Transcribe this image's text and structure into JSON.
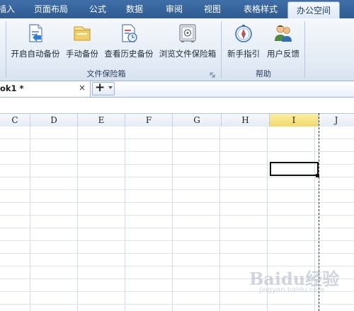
{
  "menu": {
    "tabs": [
      {
        "label": "插入",
        "partial": "插入"
      },
      {
        "label": "页面布局"
      },
      {
        "label": "公式"
      },
      {
        "label": "数据"
      },
      {
        "label": "审阅"
      },
      {
        "label": "视图"
      },
      {
        "label": "表格样式"
      },
      {
        "label": "办公空间",
        "active": true
      }
    ]
  },
  "ribbon": {
    "groups": [
      {
        "label": "文件保险箱",
        "buttons": [
          {
            "label": "开启自动备份",
            "icon": "auto-backup-icon"
          },
          {
            "label": "手动备份",
            "icon": "manual-backup-icon"
          },
          {
            "label": "查看历史备份",
            "icon": "history-backup-icon"
          },
          {
            "label": "浏览文件保险箱",
            "icon": "safe-box-icon"
          }
        ]
      },
      {
        "label": "帮助",
        "buttons": [
          {
            "label": "新手指引",
            "icon": "compass-icon"
          },
          {
            "label": "用户反馈",
            "icon": "users-icon"
          }
        ]
      }
    ]
  },
  "document": {
    "tab_name": "ok1 *",
    "close_symbol": "×",
    "new_tab_symbol": "+"
  },
  "sheet": {
    "column_headers": [
      "C",
      "D",
      "E",
      "F",
      "G",
      "H",
      "I",
      "J"
    ],
    "selected_column": "I"
  },
  "watermark": {
    "text": "Baidu经验",
    "url": "jingyan.baidu.com"
  },
  "colors": {
    "menubar": "#2f5b92",
    "ribbon_bg": "#e3ebf5",
    "selected_header": "#f3d869"
  }
}
